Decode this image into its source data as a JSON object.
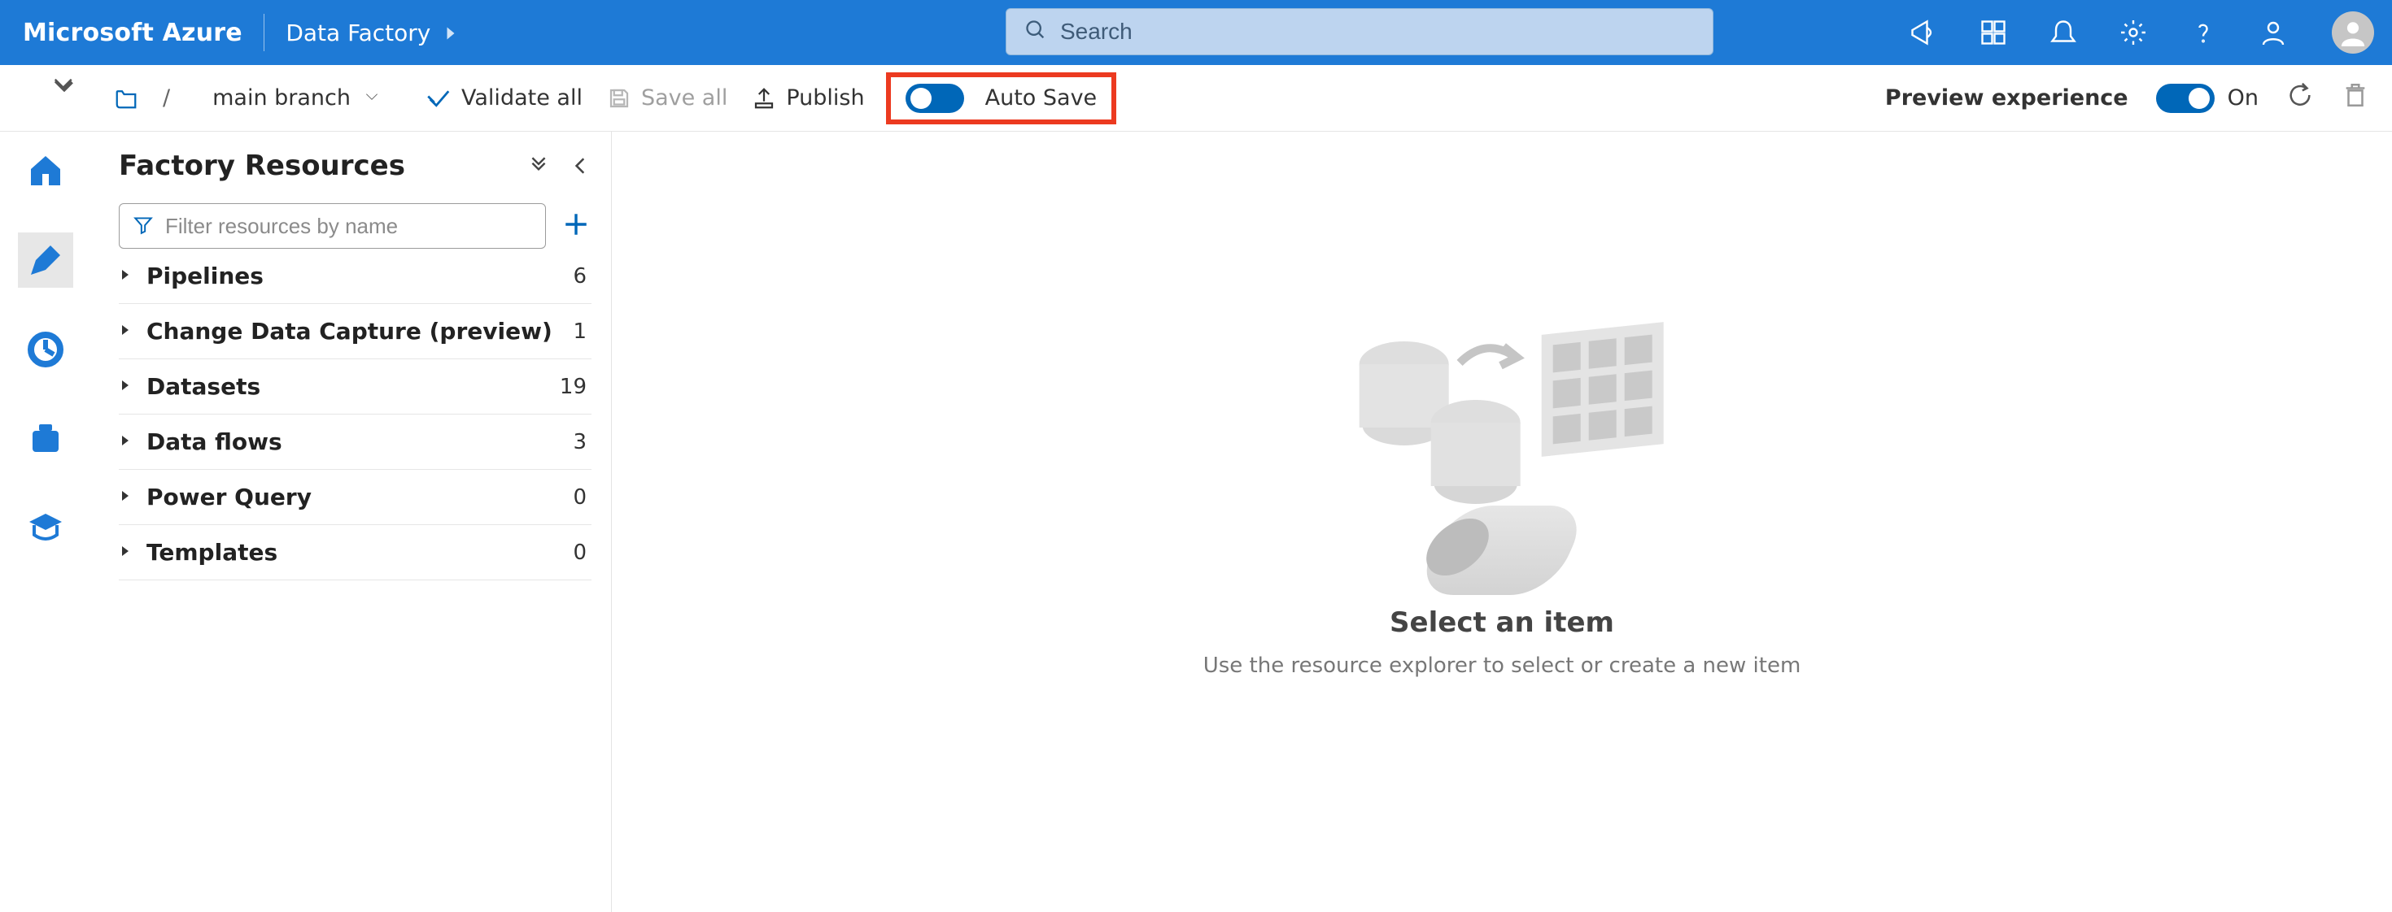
{
  "topbar": {
    "brand": "Microsoft Azure",
    "service": "Data Factory",
    "search_placeholder": "Search"
  },
  "toolbar": {
    "branch_label": "main branch",
    "validate_label": "Validate all",
    "save_all_label": "Save all",
    "publish_label": "Publish",
    "auto_save_label": "Auto Save",
    "preview_label": "Preview experience",
    "preview_switch_label": "On"
  },
  "factory": {
    "title": "Factory Resources",
    "filter_placeholder": "Filter resources by name",
    "cats": [
      {
        "name": "Pipelines",
        "count": "6"
      },
      {
        "name": "Change Data Capture (preview)",
        "count": "1"
      },
      {
        "name": "Datasets",
        "count": "19"
      },
      {
        "name": "Data flows",
        "count": "3"
      },
      {
        "name": "Power Query",
        "count": "0"
      },
      {
        "name": "Templates",
        "count": "0"
      }
    ]
  },
  "main": {
    "empty_title": "Select an item",
    "empty_sub": "Use the resource explorer to select or create a new item"
  }
}
